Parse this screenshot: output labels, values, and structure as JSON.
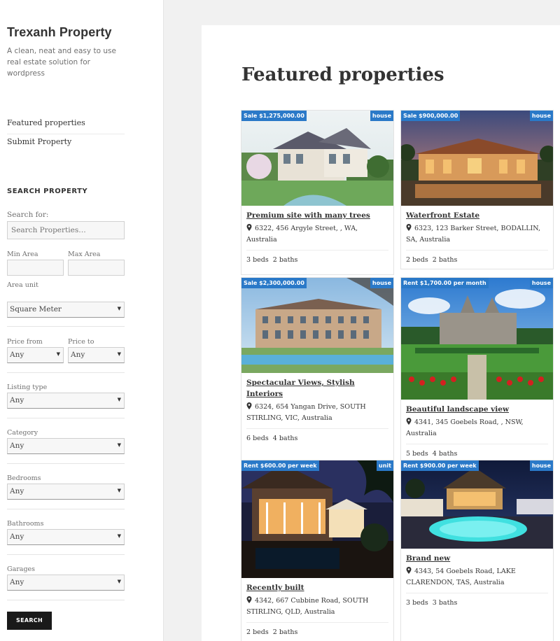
{
  "site": {
    "title": "Trexanh Property",
    "description": "A clean, neat and easy to use real estate solution for wordpress"
  },
  "menu": [
    {
      "label": "Featured properties"
    },
    {
      "label": "Submit Property"
    }
  ],
  "search_widget": {
    "title": "SEARCH PROPERTY",
    "search_for_label": "Search for:",
    "search_placeholder": "Search Properties…",
    "min_area_label": "Min Area",
    "max_area_label": "Max Area",
    "area_unit_label": "Area unit",
    "area_unit_value": "Square Meter",
    "price_from_label": "Price from",
    "price_from_value": "Any",
    "price_to_label": "Price to",
    "price_to_value": "Any",
    "listing_type_label": "Listing type",
    "listing_type_value": "Any",
    "category_label": "Category",
    "category_value": "Any",
    "bedrooms_label": "Bedrooms",
    "bedrooms_value": "Any",
    "bathrooms_label": "Bathrooms",
    "bathrooms_value": "Any",
    "garages_label": "Garages",
    "garages_value": "Any",
    "button_label": "SEARCH"
  },
  "main": {
    "page_title": "Featured properties",
    "properties": [
      {
        "price": "Sale $1,275,000.00",
        "type": "house",
        "title": "Premium site with many trees",
        "address": "6322, 456 Argyle Street, , WA, Australia",
        "beds": "3 beds",
        "baths": "2 baths"
      },
      {
        "price": "Sale $900,000.00",
        "type": "house",
        "title": "Waterfront Estate",
        "address": "6323, 123 Barker Street, BODALLIN, SA, Australia",
        "beds": "2 beds",
        "baths": "2 baths"
      },
      {
        "price": "Sale $2,300,000.00",
        "type": "house",
        "title": "Spectacular Views, Stylish Interiors",
        "address": "6324, 654 Yangan Drive, SOUTH STIRLING, VIC, Australia",
        "beds": "6 beds",
        "baths": "4 baths"
      },
      {
        "price": "Rent $1,700.00 per month",
        "type": "house",
        "title": "Beautiful landscape view",
        "address": "4341, 345 Goebels Road, , NSW, Australia",
        "beds": "5 beds",
        "baths": "4 baths"
      },
      {
        "price": "Rent $600.00 per week",
        "type": "unit",
        "title": "Recently built",
        "address": "4342, 667 Cubbine Road, SOUTH STIRLING, QLD, Australia",
        "beds": "2 beds",
        "baths": "2 baths"
      },
      {
        "price": "Rent $900.00 per week",
        "type": "house",
        "title": "Brand new",
        "address": "4343, 54 Goebels Road, LAKE CLARENDON, TAS, Australia",
        "beds": "3 beds",
        "baths": "3 baths"
      }
    ]
  },
  "colors": {
    "accent": "#2a79c8",
    "button": "#1a1a1a",
    "background": "#f1f1f1"
  },
  "icons": {
    "address": "map-pin-icon",
    "select_arrow": "caret-down-icon"
  }
}
